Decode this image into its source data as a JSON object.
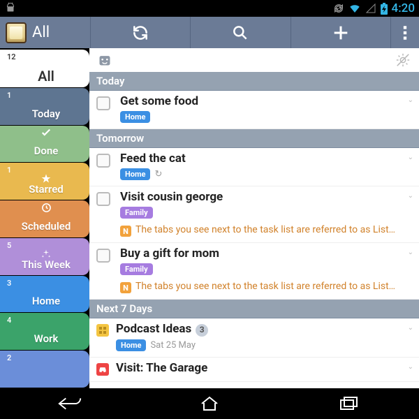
{
  "status": {
    "time": "4:20"
  },
  "actionbar": {
    "title": "All"
  },
  "sidebar": [
    {
      "id": "all",
      "count": "12",
      "label": "All",
      "color": "#fff",
      "active": true,
      "icon": ""
    },
    {
      "id": "today",
      "count": "1",
      "label": "Today",
      "color": "#5e7591",
      "icon": ""
    },
    {
      "id": "done",
      "count": "",
      "label": "Done",
      "color": "#8fbf8a",
      "icon": "check"
    },
    {
      "id": "starred",
      "count": "1",
      "label": "Starred",
      "color": "#e9b94f",
      "icon": "star"
    },
    {
      "id": "scheduled",
      "count": "",
      "label": "Scheduled",
      "color": "#e08f4f",
      "icon": "clock"
    },
    {
      "id": "thisweek",
      "count": "5",
      "label": "This Week",
      "color": "#b08fd9",
      "icon": "spark"
    },
    {
      "id": "home",
      "count": "3",
      "label": "Home",
      "color": "#3b8fe3",
      "icon": ""
    },
    {
      "id": "work",
      "count": "4",
      "label": "Work",
      "color": "#3ba36a",
      "icon": ""
    },
    {
      "id": "family",
      "count": "2",
      "label": "",
      "color": "#6b8ed9",
      "icon": ""
    }
  ],
  "sections": [
    {
      "header": "Today",
      "tasks": [
        {
          "id": "t1",
          "title": "Get some food",
          "badge": {
            "text": "Home",
            "cls": "home"
          }
        }
      ]
    },
    {
      "header": "Tomorrow",
      "tasks": [
        {
          "id": "t2",
          "title": "Feed the cat",
          "badge": {
            "text": "Home",
            "cls": "home"
          },
          "recur": true
        },
        {
          "id": "t3",
          "title": "Visit cousin george",
          "badge": {
            "text": "Family",
            "cls": "family"
          },
          "note": "The tabs you see next to the task list are referred to as List…"
        },
        {
          "id": "t4",
          "title": "Buy a gift for mom",
          "badge": {
            "text": "Family",
            "cls": "family"
          },
          "note": "The tabs you see next to the task list are referred to as List…"
        }
      ]
    },
    {
      "header": "Next 7 Days",
      "tasks": [
        {
          "id": "t5",
          "title": "Podcast Ideas",
          "count": "3",
          "listIcon": "yellow",
          "badge": {
            "text": "Home",
            "cls": "home"
          },
          "date": "Sat 25 May"
        },
        {
          "id": "t6",
          "title": "Visit: The Garage",
          "listIcon": "car"
        }
      ]
    }
  ]
}
